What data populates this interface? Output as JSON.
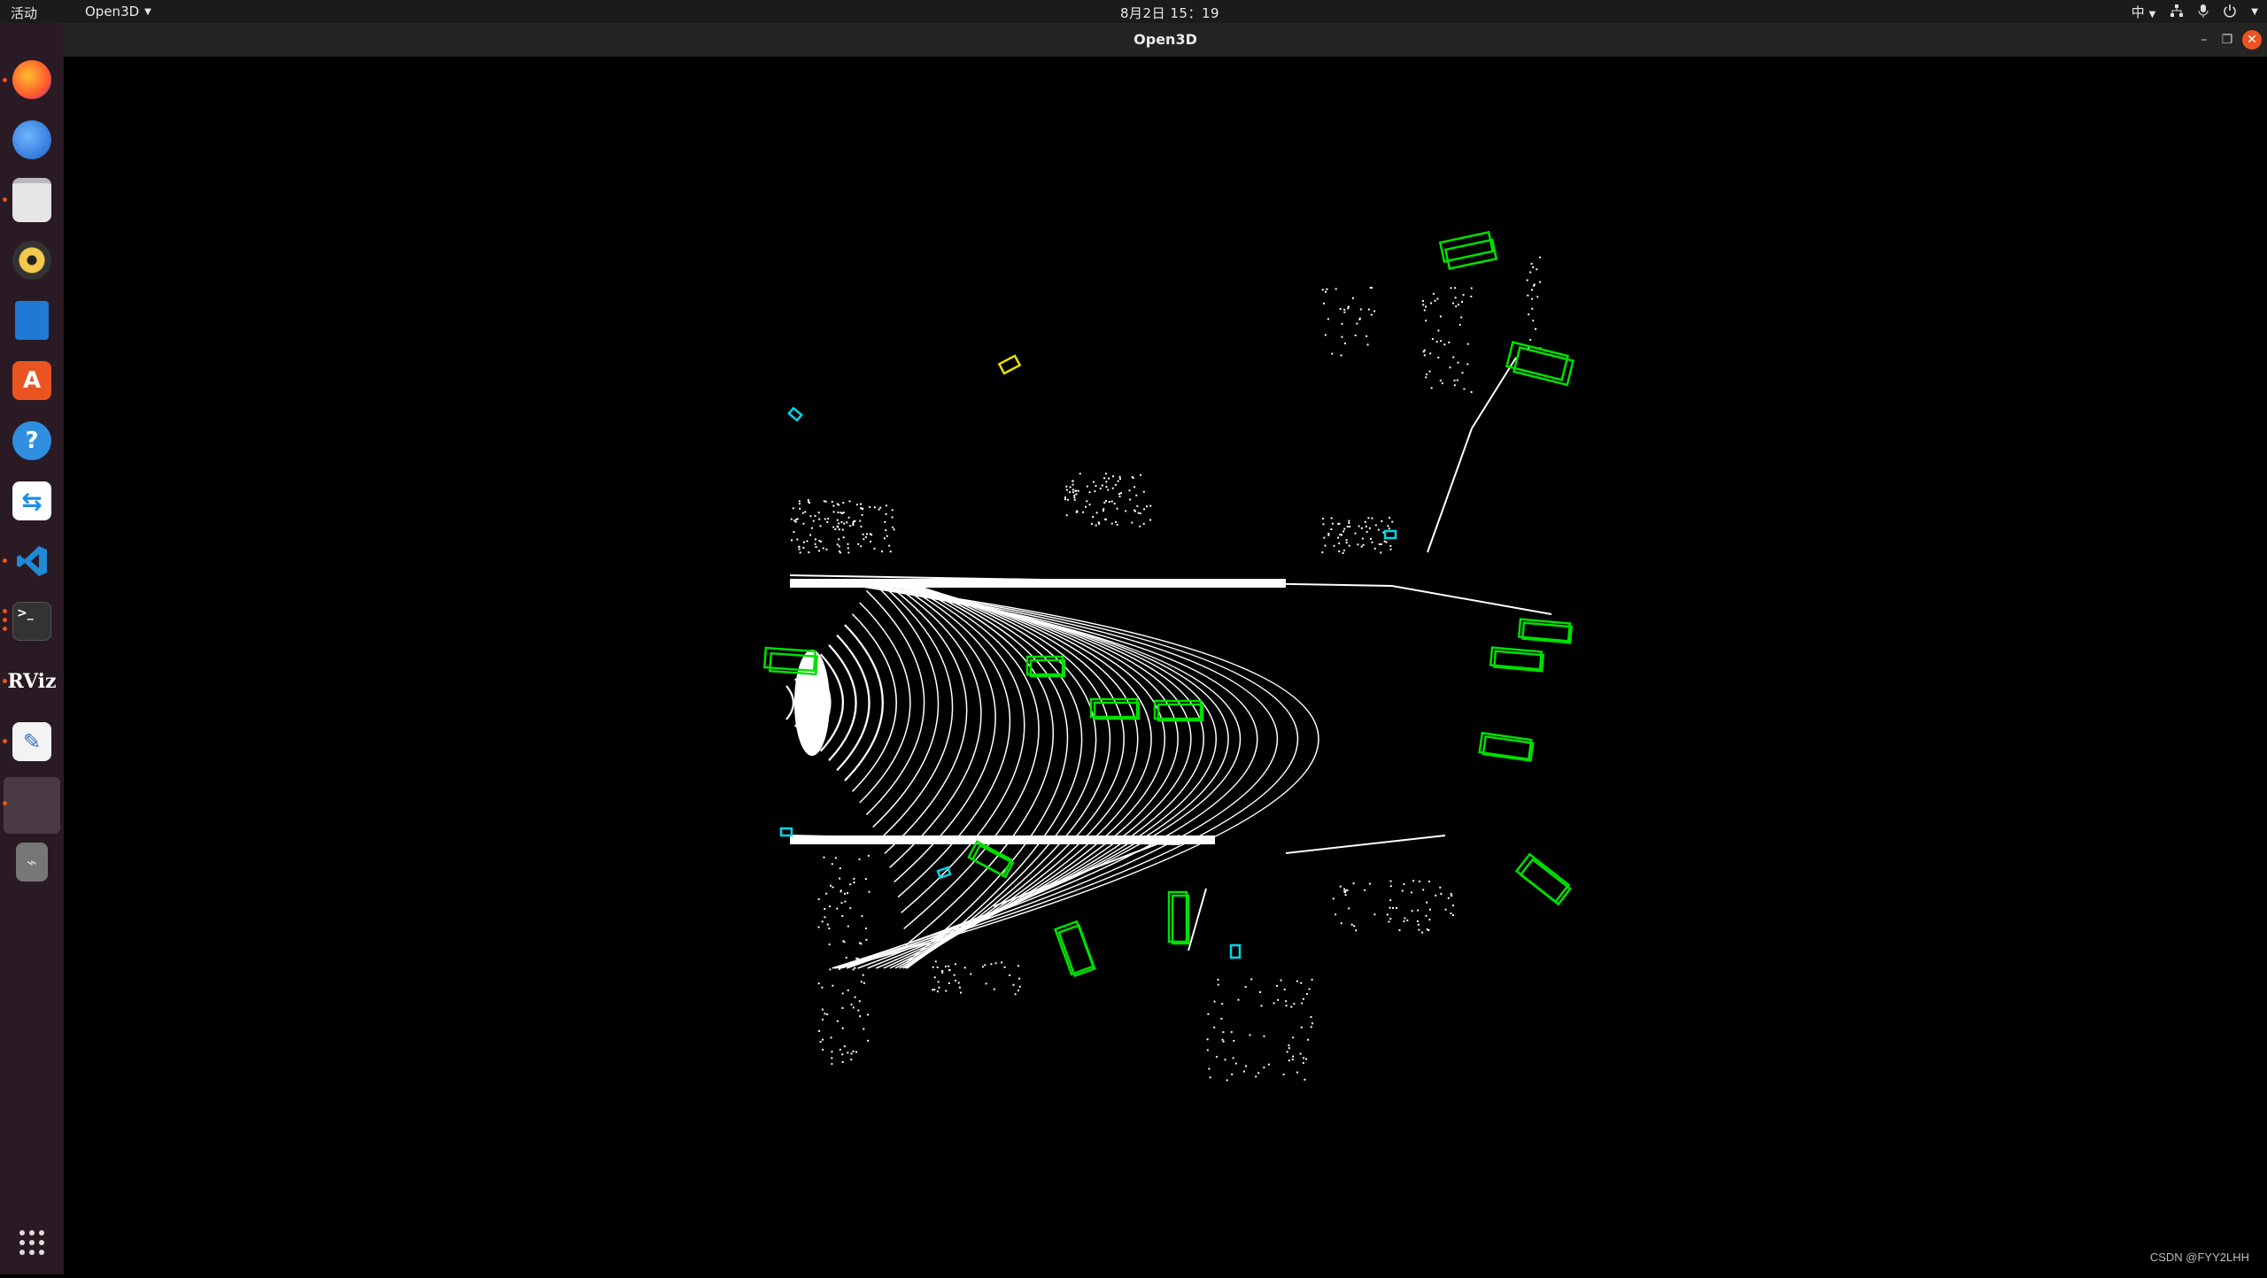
{
  "topbar": {
    "activities": "活动",
    "app_menu": "Open3D",
    "clock": "8月2日 15：19",
    "input_method": "中"
  },
  "dock": {
    "items": [
      {
        "name": "firefox",
        "icon": "firefox-icon",
        "running": true
      },
      {
        "name": "thunderbird",
        "icon": "thunderbird-icon",
        "running": false
      },
      {
        "name": "files",
        "icon": "files-icon",
        "running": true
      },
      {
        "name": "rhythmbox",
        "icon": "rhythmbox-icon",
        "running": false
      },
      {
        "name": "libreoffice-writer",
        "icon": "writer-icon",
        "running": false
      },
      {
        "name": "ubuntu-software",
        "icon": "software-icon",
        "running": false
      },
      {
        "name": "help",
        "icon": "help-icon",
        "running": false
      },
      {
        "name": "teamviewer",
        "icon": "teamviewer-icon",
        "running": false
      },
      {
        "name": "vscode",
        "icon": "vscode-icon",
        "running": true
      },
      {
        "name": "terminal",
        "icon": "terminal-icon",
        "running": true
      },
      {
        "name": "rviz",
        "icon": "rviz-icon",
        "label": "RViz",
        "running": true
      },
      {
        "name": "text-editor",
        "icon": "text-editor-icon",
        "running": true
      },
      {
        "name": "open3d",
        "icon": "open3d-window-icon",
        "running": true
      },
      {
        "name": "usb",
        "icon": "usb-icon",
        "running": false
      }
    ],
    "apps_grid_icon": "app-grid-icon"
  },
  "window": {
    "title": "Open3D"
  },
  "watermark": "CSDN @FYY2LHH",
  "colors": {
    "car_box": "#00e000",
    "cyclist_box": "#00d8e8",
    "pedestrian_box": "#e8e000",
    "points": "#ffffff"
  }
}
